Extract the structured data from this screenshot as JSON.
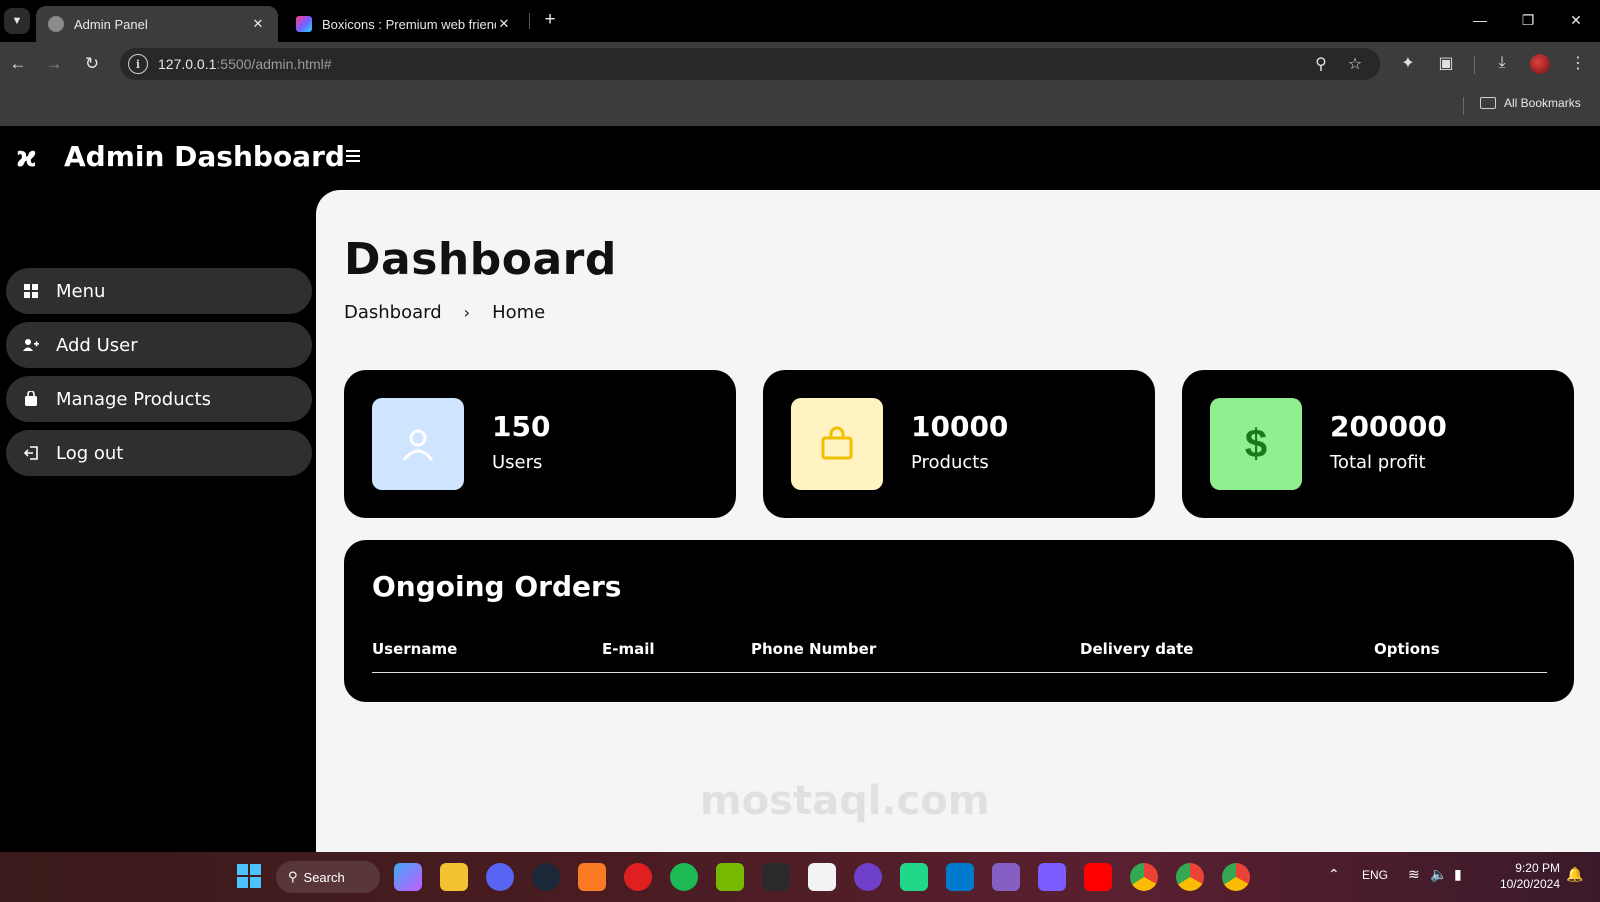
{
  "browser": {
    "tabs": [
      {
        "title": "Admin Panel",
        "active": true
      },
      {
        "title": "Boxicons : Premium web friendl",
        "active": false
      }
    ],
    "url_host": "127.0.0.1",
    "url_path": ":5500/admin.html#",
    "bookmarks_label": "All Bookmarks"
  },
  "app": {
    "title": "Admin Dashboard",
    "logo_glyph": "ϰ"
  },
  "sidebar": {
    "items": [
      {
        "label": "Menu",
        "icon": "grid-icon"
      },
      {
        "label": "Add User",
        "icon": "user-plus-icon"
      },
      {
        "label": "Manage Products",
        "icon": "bag-icon"
      },
      {
        "label": "Log out",
        "icon": "logout-icon"
      }
    ]
  },
  "main": {
    "heading": "Dashboard",
    "breadcrumb": [
      "Dashboard",
      "Home"
    ],
    "breadcrumb_sep": "›",
    "stats": [
      {
        "value": "150",
        "label": "Users",
        "icon": "user-icon",
        "badge_color": "#cfe5ff",
        "icon_color": "#ffffff"
      },
      {
        "value": "10000",
        "label": "Products",
        "icon": "shopping-bag-icon",
        "badge_color": "#fff3c4",
        "icon_color": "#f0c000"
      },
      {
        "value": "200000",
        "label": "Total profit",
        "icon": "dollar-icon",
        "badge_color": "#8ff08f",
        "icon_color": "#1a7a1a"
      }
    ],
    "orders": {
      "title": "Ongoing Orders",
      "columns": [
        "Username",
        "E-mail",
        "Phone Number",
        "Delivery date",
        "Options"
      ]
    }
  },
  "taskbar": {
    "search_label": "Search",
    "language": "ENG",
    "time": "9:20 PM",
    "date": "10/20/2024"
  },
  "watermark": "mostaql.com"
}
